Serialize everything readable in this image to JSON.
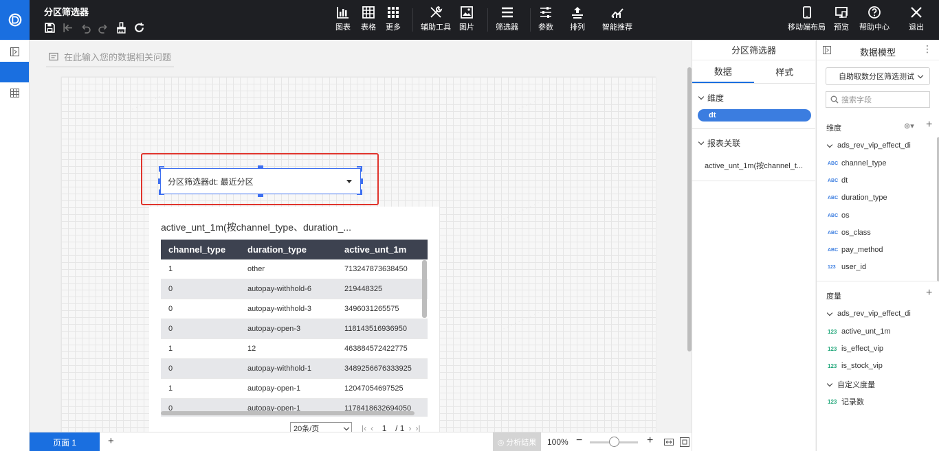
{
  "header": {
    "title": "分区筛选器",
    "tools": [
      {
        "name": "chart",
        "label": "图表"
      },
      {
        "name": "table",
        "label": "表格"
      },
      {
        "name": "more",
        "label": "更多"
      },
      {
        "name": "aux",
        "label": "辅助工具"
      },
      {
        "name": "image",
        "label": "图片"
      },
      {
        "name": "filter",
        "label": "筛选器"
      },
      {
        "name": "params",
        "label": "参数"
      },
      {
        "name": "sort",
        "label": "排列"
      },
      {
        "name": "smart",
        "label": "智能推荐"
      }
    ],
    "right_tools": [
      {
        "name": "mobile",
        "label": "移动端布局"
      },
      {
        "name": "preview",
        "label": "预览"
      },
      {
        "name": "help",
        "label": "帮助中心"
      },
      {
        "name": "exit",
        "label": "退出"
      }
    ]
  },
  "workspace": {
    "question_placeholder": "在此输入您的数据相关问题",
    "filter_text": "分区筛选器dt: 最近分区",
    "table": {
      "title": "active_unt_1m(按channel_type、duration_...",
      "columns": [
        "channel_type",
        "duration_type",
        "active_unt_1m"
      ],
      "rows": [
        [
          "1",
          "other",
          "713247873638450"
        ],
        [
          "0",
          "autopay-withhold-6",
          "219448325"
        ],
        [
          "0",
          "autopay-withhold-3",
          "3496031265575"
        ],
        [
          "0",
          "autopay-open-3",
          "118143516936950"
        ],
        [
          "1",
          "12",
          "463884572422775"
        ],
        [
          "0",
          "autopay-withhold-1",
          "3489256676333925"
        ],
        [
          "1",
          "autopay-open-1",
          "12047054697525"
        ],
        [
          "0",
          "autopay-open-1",
          "1178418632694050"
        ]
      ],
      "page_size": "20条/页",
      "page_current": "1",
      "page_total": "/ 1"
    }
  },
  "bottombar": {
    "page_tab": "页面 1",
    "add": "+",
    "analyze": "分析结果",
    "zoom": "100%",
    "zoom_level": 0.5
  },
  "panel1": {
    "title": "分区筛选器",
    "tabs": [
      "数据",
      "样式"
    ],
    "dimension_label": "维度",
    "dimension_value": "dt",
    "report_link_label": "报表关联",
    "report_link_value": "active_unt_1m(按channel_t..."
  },
  "panel2": {
    "title": "数据模型",
    "dataset": "自助取数分区筛选测试",
    "search_placeholder": "搜索字段",
    "dimension_label": "维度",
    "dimension_table": "ads_rev_vip_effect_di",
    "dimension_fields": [
      {
        "type": "ABC",
        "name": "channel_type"
      },
      {
        "type": "ABC",
        "name": "dt"
      },
      {
        "type": "ABC",
        "name": "duration_type"
      },
      {
        "type": "ABC",
        "name": "os"
      },
      {
        "type": "ABC",
        "name": "os_class"
      },
      {
        "type": "ABC",
        "name": "pay_method"
      },
      {
        "type": "123",
        "name": "user_id"
      }
    ],
    "measure_label": "度量",
    "measure_table": "ads_rev_vip_effect_di",
    "measure_fields": [
      {
        "type": "123",
        "name": "active_unt_1m"
      },
      {
        "type": "123",
        "name": "is_effect_vip"
      },
      {
        "type": "123",
        "name": "is_stock_vip"
      }
    ],
    "custom_measure_label": "自定义度量",
    "custom_measure_fields": [
      {
        "type": "123",
        "name": "记录数"
      }
    ]
  }
}
